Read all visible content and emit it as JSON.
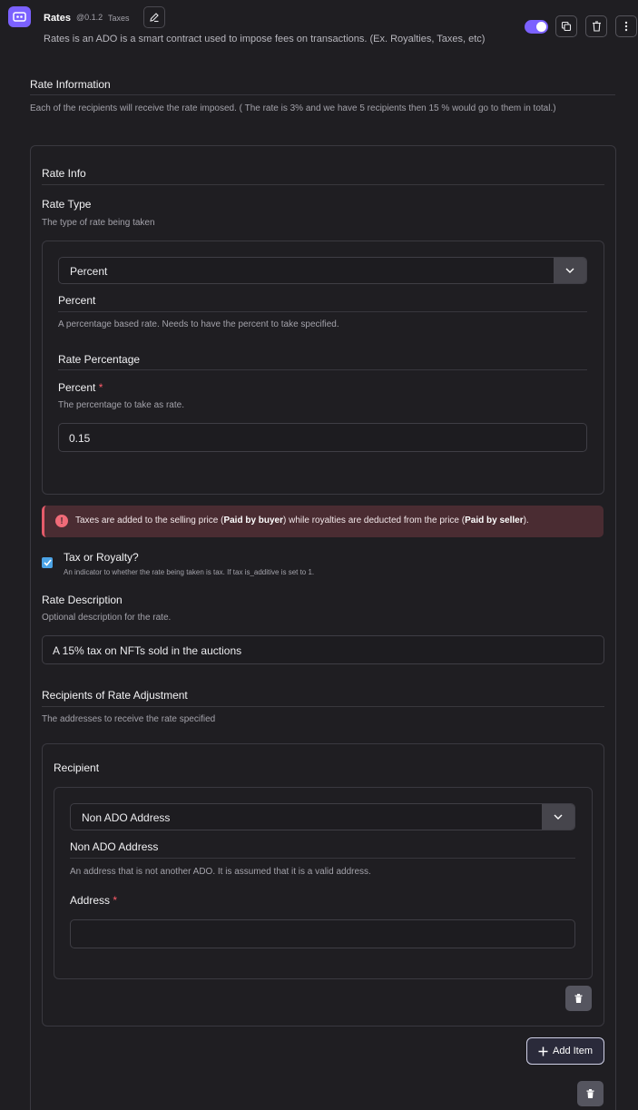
{
  "header": {
    "title": "Rates",
    "version": "@0.1.2",
    "badge": "Taxes",
    "subtitle": "Rates is an ADO is a smart contract used to impose fees on transactions. (Ex. Royalties, Taxes, etc)"
  },
  "rate_information": {
    "heading": "Rate Information",
    "description": "Each of the recipients will receive the rate imposed. ( The rate is 3% and we have 5 recipients then 15 % would go to them in total.)"
  },
  "rate_info": {
    "heading": "Rate Info",
    "rate_type_label": "Rate Type",
    "rate_type_help": "The type of rate being taken",
    "rate_type_selected": "Percent",
    "percent_heading": "Percent",
    "percent_description": "A percentage based rate. Needs to have the percent to take specified.",
    "rate_percentage_heading": "Rate Percentage",
    "percent_field_label": "Percent",
    "required_mark": "*",
    "percent_field_help": "The percentage to take as rate.",
    "percent_value": "0.15"
  },
  "alert": {
    "part1": "Taxes are added to the selling price (",
    "bold1": "Paid by buyer",
    "part2": ") while royalties are deducted from the price (",
    "bold2": "Paid by seller",
    "part3": ")."
  },
  "tax_checkbox": {
    "label": "Tax or Royalty?",
    "help": "An indicator to whether the rate being taken is tax. If tax is_additive is set to 1.",
    "checked": true
  },
  "rate_description": {
    "label": "Rate Description",
    "help": "Optional description for the rate.",
    "value": "A 15% tax on NFTs sold in the auctions"
  },
  "recipients": {
    "heading": "Recipients of Rate Adjustment",
    "help": "The addresses to receive the rate specified",
    "recipient_label": "Recipient",
    "type_selected": "Non ADO Address",
    "type_heading": "Non ADO Address",
    "type_description": "An address that is not another ADO. It is assumed that it is a valid address.",
    "address_label": "Address",
    "required_mark": "*",
    "address_value": ""
  },
  "buttons": {
    "add_item": "Add Item"
  },
  "colors": {
    "accent": "#7b61ff",
    "background": "#1f1e22",
    "alert_bg": "#4a2c32",
    "checkbox": "#4ba3e6"
  }
}
